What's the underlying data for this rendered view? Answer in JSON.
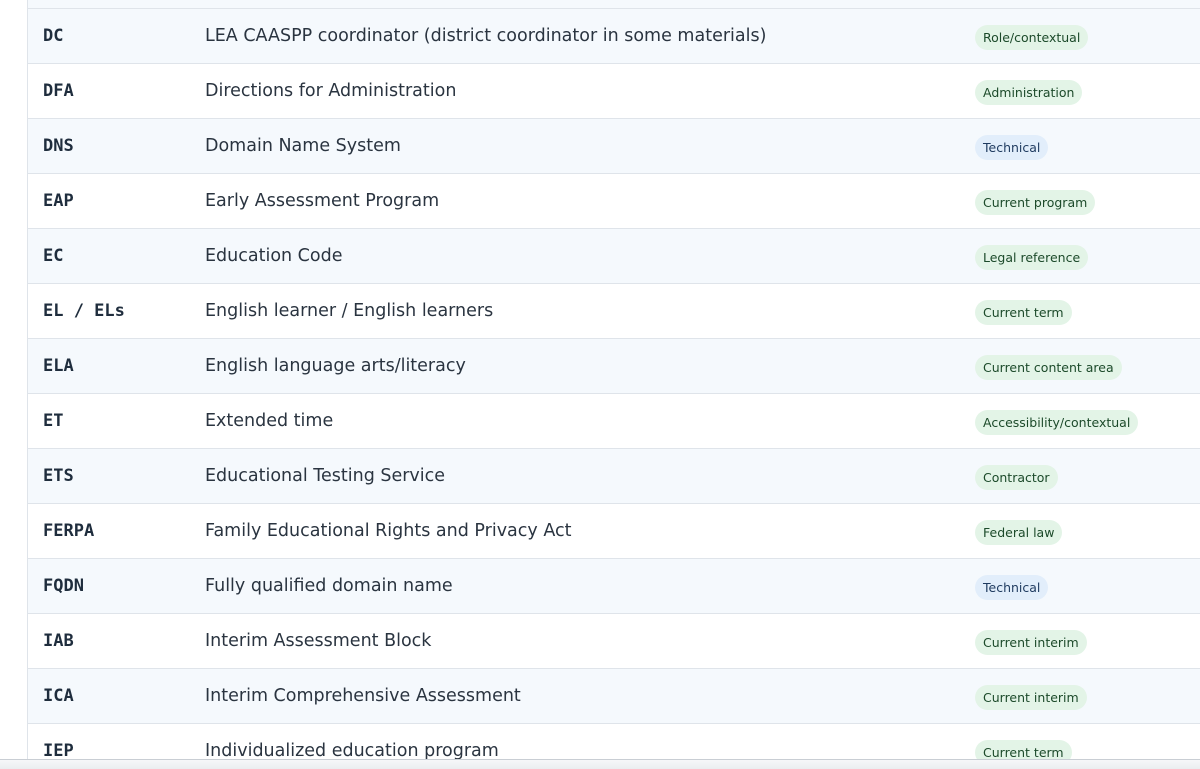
{
  "rows": [
    {
      "abbr": "DC",
      "meaning": "LEA CAASPP coordinator (district coordinator in some materials)",
      "category": "Role/contextual",
      "tone": "green"
    },
    {
      "abbr": "DFA",
      "meaning": "Directions for Administration",
      "category": "Administration",
      "tone": "green"
    },
    {
      "abbr": "DNS",
      "meaning": "Domain Name System",
      "category": "Technical",
      "tone": "blue"
    },
    {
      "abbr": "EAP",
      "meaning": "Early Assessment Program",
      "category": "Current program",
      "tone": "green"
    },
    {
      "abbr": "EC",
      "meaning": "Education Code",
      "category": "Legal reference",
      "tone": "green"
    },
    {
      "abbr": "EL / ELs",
      "meaning": "English learner / English learners",
      "category": "Current term",
      "tone": "green"
    },
    {
      "abbr": "ELA",
      "meaning": "English language arts/literacy",
      "category": "Current content area",
      "tone": "green"
    },
    {
      "abbr": "ET",
      "meaning": "Extended time",
      "category": "Accessibility/contextual",
      "tone": "green"
    },
    {
      "abbr": "ETS",
      "meaning": "Educational Testing Service",
      "category": "Contractor",
      "tone": "green"
    },
    {
      "abbr": "FERPA",
      "meaning": "Family Educational Rights and Privacy Act",
      "category": "Federal law",
      "tone": "green"
    },
    {
      "abbr": "FQDN",
      "meaning": "Fully qualified domain name",
      "category": "Technical",
      "tone": "blue"
    },
    {
      "abbr": "IAB",
      "meaning": "Interim Assessment Block",
      "category": "Current interim",
      "tone": "green"
    },
    {
      "abbr": "ICA",
      "meaning": "Interim Comprehensive Assessment",
      "category": "Current interim",
      "tone": "green"
    },
    {
      "abbr": "IEP",
      "meaning": "Individualized education program",
      "category": "Current term",
      "tone": "green"
    }
  ],
  "colors": {
    "row_alt": "#f5f9fd",
    "badge_green": "#e3f4e7",
    "badge_blue": "#e2eefb"
  }
}
